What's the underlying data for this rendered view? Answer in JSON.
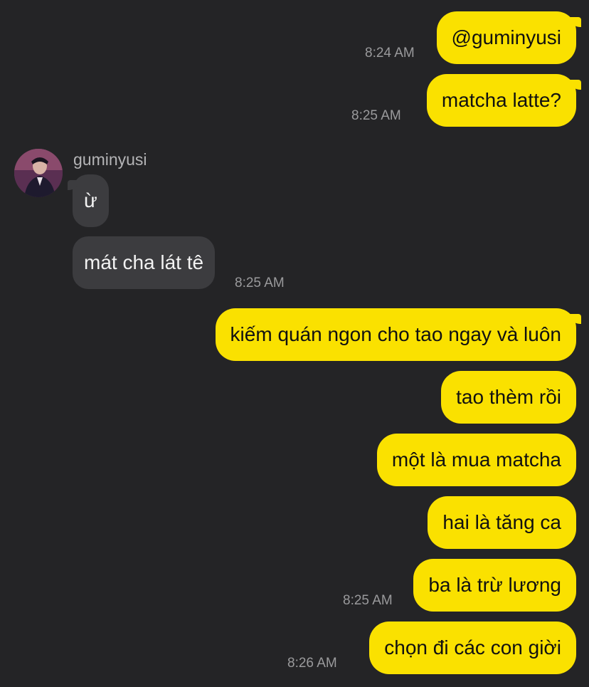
{
  "chat": {
    "contact": {
      "name": "guminyusi",
      "avatar_icon": "profile-photo"
    },
    "messages": [
      {
        "text": "@guminyusi",
        "time": "8:24 AM"
      },
      {
        "text": "matcha latte?",
        "time": "8:25 AM"
      },
      {
        "text": "ừ"
      },
      {
        "text": "mát cha lát tê",
        "time": "8:25 AM"
      },
      {
        "text": "kiếm quán ngon cho tao ngay và luôn"
      },
      {
        "text": "tao thèm rồi"
      },
      {
        "text": "một là mua matcha"
      },
      {
        "text": "hai là tăng ca"
      },
      {
        "text": "ba là trừ lương",
        "time": "8:25 AM"
      },
      {
        "text": "chọn đi các con giời",
        "time": "8:26 AM"
      }
    ],
    "colors": {
      "background": "#242426",
      "outgoing_bubble": "#fae100",
      "incoming_bubble": "#3c3c3f",
      "timestamp": "#9a9a9c"
    }
  }
}
